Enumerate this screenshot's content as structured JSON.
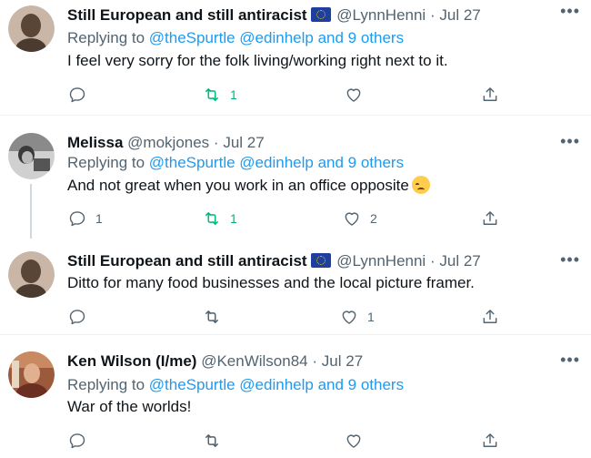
{
  "replying_to_label": "Replying to",
  "more_label": "•••",
  "tweets": [
    {
      "name": "Still European and still antiracist",
      "handle": "@LynnHenni",
      "date": "Jul 27",
      "replying_to": [
        "@theSpurtle",
        "@edinhelp",
        "and 9 others"
      ],
      "text": "I feel very sorry for the folk living/working right next to it.",
      "reply_count": "",
      "retweet_count": "1",
      "like_count": ""
    },
    {
      "name": "Melissa",
      "handle": "@mokjones",
      "date": "Jul 27",
      "replying_to": [
        "@theSpurtle",
        "@edinhelp",
        "and 9 others"
      ],
      "text": "And not great when you work in an office opposite",
      "reply_count": "1",
      "retweet_count": "1",
      "like_count": "2"
    },
    {
      "name": "Still European and still antiracist",
      "handle": "@LynnHenni",
      "date": "Jul 27",
      "text": "Ditto for many food businesses and the local picture framer.",
      "reply_count": "",
      "retweet_count": "",
      "like_count": "1"
    },
    {
      "name": "Ken Wilson (I/me)",
      "handle": "@KenWilson84",
      "date": "Jul 27",
      "replying_to": [
        "@theSpurtle",
        "@edinhelp",
        "and 9 others"
      ],
      "text": "War of the worlds!",
      "reply_count": "",
      "retweet_count": "",
      "like_count": ""
    }
  ],
  "colors": {
    "link": "#1d9bf0",
    "muted": "#536471",
    "retweet_active": "#00ba7c",
    "text": "#0f1419"
  }
}
